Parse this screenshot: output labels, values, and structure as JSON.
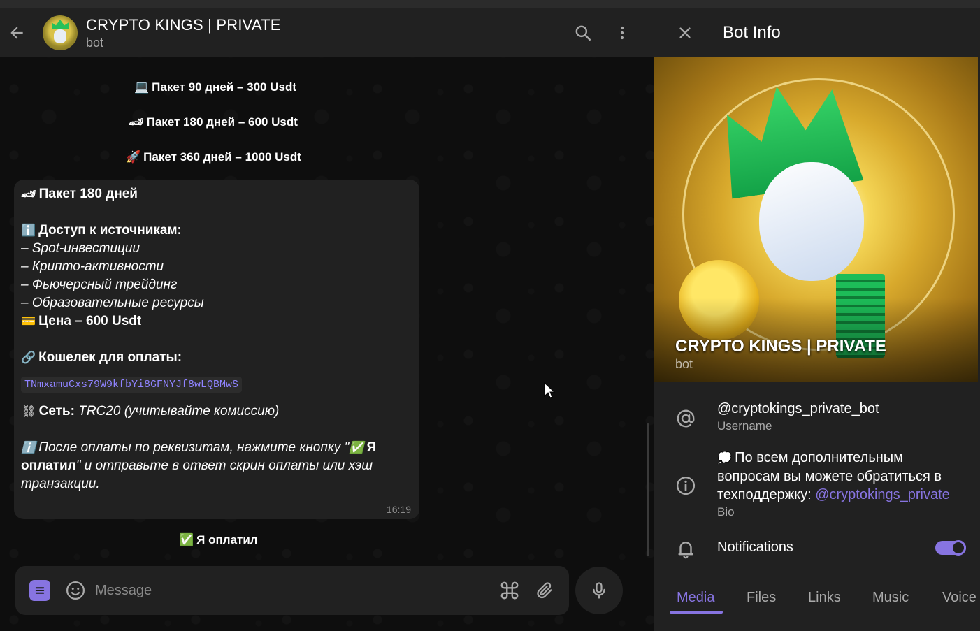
{
  "chat": {
    "title": "CRYPTO KINGS | PRIVATE",
    "subtitle": "bot",
    "service_messages": [
      {
        "emoji": "💻",
        "text": "Пакет 90 дней – 300 Usdt"
      },
      {
        "emoji": "🏎",
        "text": "Пакет 180 дней – 600 Usdt"
      },
      {
        "emoji": "🚀",
        "text": "Пакет 360 дней – 1000 Usdt"
      }
    ],
    "message": {
      "package": "Пакет 180 дней",
      "access_title": "Доступ к источникам:",
      "access_items": [
        "– Spot-инвестиции",
        "– Крипто-активности",
        "– Фьючерсный трейдинг",
        "– Образовательные ресурсы"
      ],
      "price": "Цена – 600 Usdt",
      "wallet_title": "Кошелек для оплаты:",
      "wallet_address": "TNmxamuCxs79W9kfbYi8GFNYJf8wLQBMwS",
      "network_label": "Сеть:",
      "network_value": "TRC20 (учитывайте комиссию)",
      "after_payment_1": "После оплаты по реквизитам, нажмите кнопку \"",
      "after_payment_bold": "Я оплатил",
      "after_payment_2": "\" и отправьте в ответ скрин оплаты или хэш транзакции.",
      "time": "16:19"
    },
    "paid_button": "Я оплатил",
    "input_placeholder": "Message"
  },
  "panel": {
    "title": "Bot Info",
    "cover_name": "CRYPTO KINGS | PRIVATE",
    "cover_sub": "bot",
    "username": "@cryptokings_private_bot",
    "username_label": "Username",
    "bio_text": "По всем дополнительным вопросам вы можете обратиться в техподдержку: ",
    "bio_link": "@cryptokings_private",
    "bio_label": "Bio",
    "notifications_label": "Notifications",
    "notifications_on": true,
    "tabs": [
      "Media",
      "Files",
      "Links",
      "Music",
      "Voice"
    ],
    "active_tab": "Media"
  },
  "colors": {
    "accent": "#8774e1",
    "background": "#0e0e0e",
    "surface": "#212121"
  }
}
